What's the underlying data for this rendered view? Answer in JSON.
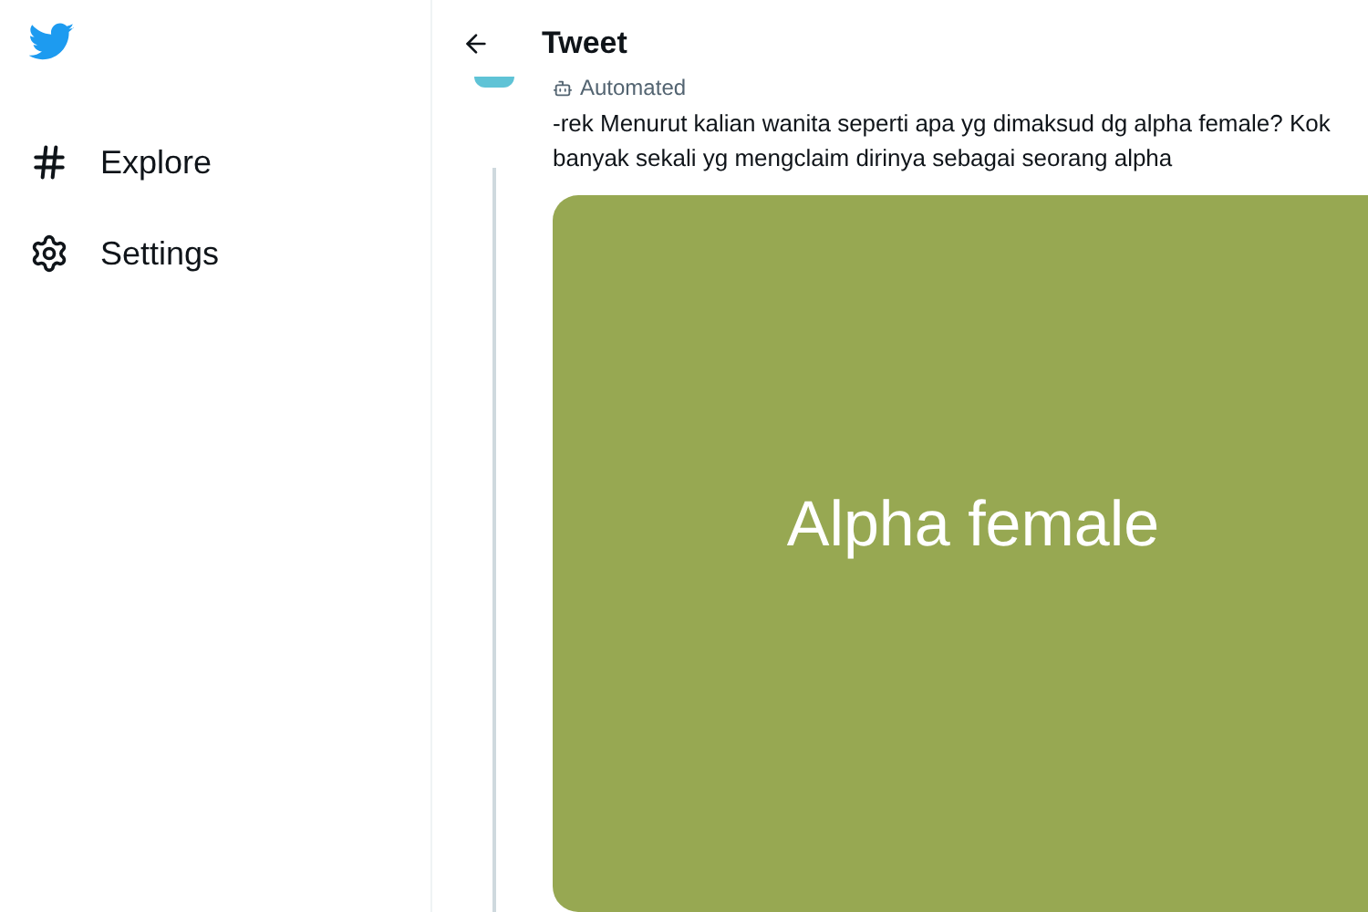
{
  "sidebar": {
    "items": [
      {
        "kind": "explore",
        "label": "Explore"
      },
      {
        "kind": "settings",
        "label": "Settings"
      }
    ]
  },
  "header": {
    "title": "Tweet"
  },
  "tweet": {
    "badge": "Automated",
    "text": "-rek Menurut kalian wanita seperti apa yg dimaksud dg alpha female? Kok banyak sekali yg mengclaim dirinya sebagai seorang alpha",
    "media": {
      "caption": "Alpha female"
    }
  }
}
